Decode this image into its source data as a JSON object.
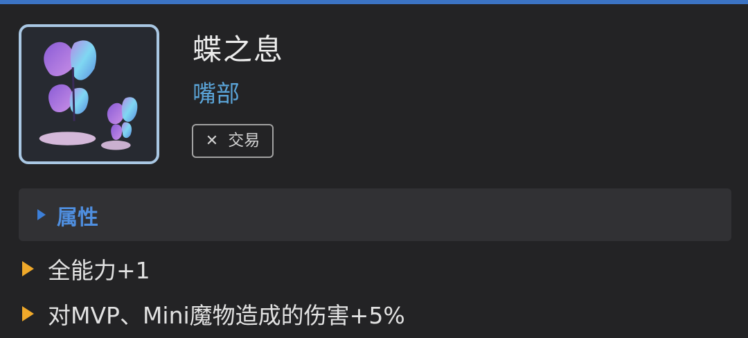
{
  "item": {
    "name": "蝶之息",
    "slot": "嘴部",
    "trade_icon": "close-icon",
    "trade_label": "交易"
  },
  "attributes": {
    "section_title": "属性",
    "items": [
      {
        "text": "全能力+1"
      },
      {
        "text": "对MVP、Mini魔物造成的伤害+5%"
      }
    ]
  },
  "colors": {
    "top_border": "#3b73c4",
    "frame_border": "#a9c7e3",
    "slot_text": "#5aa3d6",
    "section_title": "#4f8fe0",
    "bullet": "#f0a92a",
    "background": "#232325"
  }
}
